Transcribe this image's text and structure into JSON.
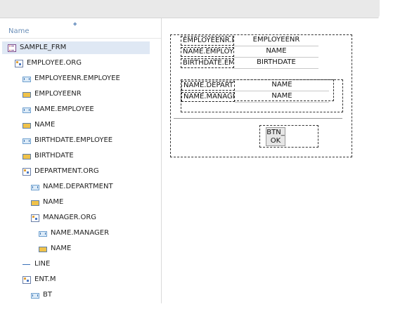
{
  "tree": {
    "column_header": "Name",
    "items": [
      {
        "label": "SAMPLE_FRM",
        "icon": "form-icon",
        "selected": true
      },
      {
        "label": "EMPLOYEE.ORG",
        "icon": "org-icon"
      },
      {
        "label": "EMPLOYEENR.EMPLOYEE",
        "icon": "label-icon"
      },
      {
        "label": "EMPLOYEENR",
        "icon": "field-icon"
      },
      {
        "label": "NAME.EMPLOYEE",
        "icon": "label-icon"
      },
      {
        "label": "NAME",
        "icon": "field-icon"
      },
      {
        "label": "BIRTHDATE.EMPLOYEE",
        "icon": "label-icon"
      },
      {
        "label": "BIRTHDATE",
        "icon": "field-icon"
      },
      {
        "label": "DEPARTMENT.ORG",
        "icon": "org-icon"
      },
      {
        "label": "NAME.DEPARTMENT",
        "icon": "label-icon"
      },
      {
        "label": "NAME",
        "icon": "field-icon"
      },
      {
        "label": "MANAGER.ORG",
        "icon": "org-icon"
      },
      {
        "label": "NAME.MANAGER",
        "icon": "label-icon"
      },
      {
        "label": "NAME",
        "icon": "field-icon"
      },
      {
        "label": "LINE",
        "icon": "line-icon"
      },
      {
        "label": "ENT.M",
        "icon": "org-icon"
      },
      {
        "label": "BT",
        "icon": "label-icon"
      }
    ]
  },
  "designer": {
    "labels": [
      "EMPLOYEENR.E",
      "NAME.EMPLOY",
      "BIRTHDATE.EM",
      "NAME.DEPARTI",
      "NAME.MANAGE"
    ],
    "fields": [
      "EMPLOYEENR",
      "NAME",
      "BIRTHDATE",
      "NAME",
      "NAME"
    ],
    "button_label": "BTN_\nOK"
  }
}
